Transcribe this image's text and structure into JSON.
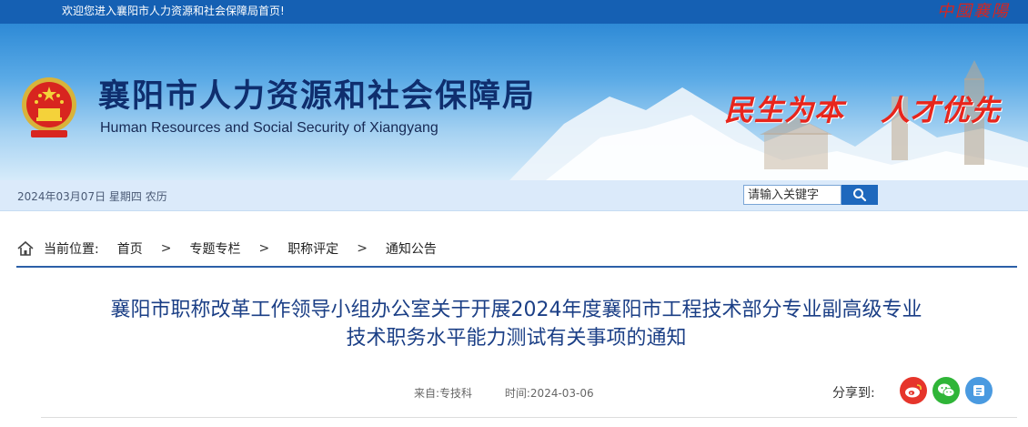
{
  "topbar": {
    "welcome": "欢迎您进入襄阳市人力资源和社会保障局首页!",
    "seal": "中國襄陽"
  },
  "header": {
    "title_cn": "襄阳市人力资源和社会保障局",
    "title_en": "Human Resources and Social Security of Xiangyang",
    "slogan_left": "民生为本",
    "slogan_right": "人才优先"
  },
  "datebar": {
    "date": "2024年03月07日 星期四 农历"
  },
  "search": {
    "placeholder": "请输入关键字",
    "icon": "search-icon"
  },
  "breadcrumb": {
    "label": "当前位置:",
    "items": [
      "首页",
      "专题专栏",
      "职称评定",
      "通知公告"
    ],
    "separator": ">"
  },
  "article": {
    "title_line1": "襄阳市职称改革工作领导小组办公室关于开展2024年度襄阳市工程技术部分专业副高级专业",
    "title_line2": "技术职务水平能力测试有关事项的通知",
    "source": "来自:专技科",
    "time": "时间:2024-03-06"
  },
  "share": {
    "label": "分享到:",
    "buttons": [
      "weibo-icon",
      "wechat-icon",
      "share-other-icon"
    ]
  },
  "colors": {
    "topbar": "#1560b3",
    "title": "#1b3f86",
    "accent_red": "#e8251c"
  }
}
